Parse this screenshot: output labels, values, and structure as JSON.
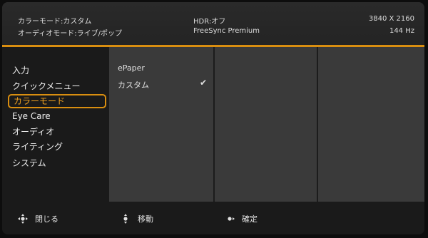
{
  "header": {
    "color_mode": "カラーモード:カスタム",
    "audio_mode": "オーディオモード:ライブ/ポップ",
    "hdr": "HDR:オフ",
    "freesync": "FreeSync Premium",
    "resolution": "3840 X 2160",
    "refresh": "144 Hz"
  },
  "menu": {
    "items": [
      {
        "label": "入力"
      },
      {
        "label": "クイックメニュー"
      },
      {
        "label": "カラーモード"
      },
      {
        "label": "Eye Care"
      },
      {
        "label": "オーディオ"
      },
      {
        "label": "ライティング"
      },
      {
        "label": "システム"
      }
    ],
    "selected_index": 2
  },
  "submenu": {
    "items": [
      {
        "label": "ePaper",
        "checked": false
      },
      {
        "label": "カスタム",
        "checked": true
      }
    ]
  },
  "footer": {
    "close": "閉じる",
    "move": "移動",
    "confirm": "確定"
  },
  "colors": {
    "accent": "#d98e10"
  }
}
